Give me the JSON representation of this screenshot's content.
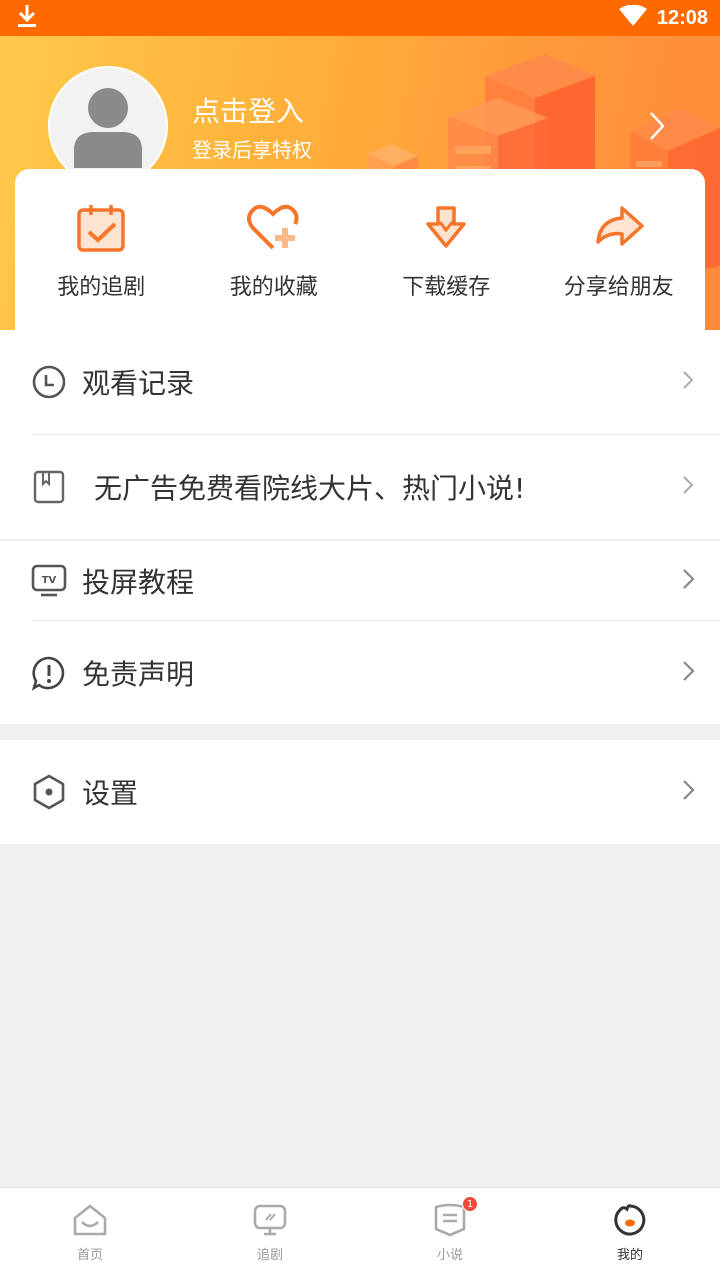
{
  "status_bar": {
    "time": "12:08"
  },
  "profile": {
    "login_title": "点击登入",
    "login_subtitle": "登录后享特权"
  },
  "quick_actions": [
    {
      "label": "我的追剧",
      "icon": "calendar-check-icon"
    },
    {
      "label": "我的收藏",
      "icon": "heart-plus-icon"
    },
    {
      "label": "下载缓存",
      "icon": "download-icon"
    },
    {
      "label": "分享给朋友",
      "icon": "share-arrow-icon"
    }
  ],
  "menu": {
    "history": "观看记录",
    "promo": "无广告免费看院线大片、热门小说!",
    "cast_tutorial": "投屏教程",
    "disclaimer": "免责声明",
    "settings": "设置"
  },
  "bottom_nav": [
    {
      "label": "首页",
      "icon": "home-icon"
    },
    {
      "label": "追剧",
      "icon": "tv-icon"
    },
    {
      "label": "小说",
      "icon": "book-icon",
      "badge": "1"
    },
    {
      "label": "我的",
      "icon": "profile-icon",
      "active": true
    }
  ],
  "colors": {
    "accent": "#ff6a00",
    "icon_orange": "#f6752b",
    "badge": "#f04b3b"
  }
}
